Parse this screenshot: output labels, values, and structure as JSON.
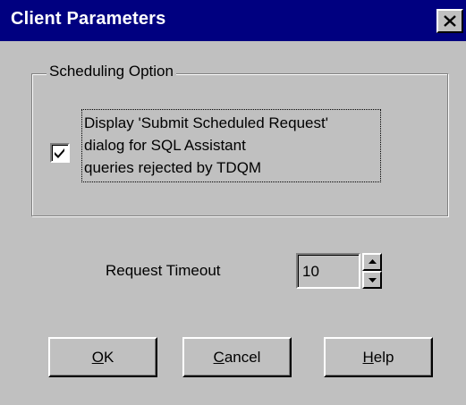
{
  "window": {
    "title": "Client Parameters",
    "close_icon": "close-icon"
  },
  "scheduling": {
    "group_label": "Scheduling Option",
    "checkbox_checked": true,
    "checkbox_label": "Display 'Submit Scheduled Request'\ndialog for SQL Assistant\nqueries rejected by TDQM"
  },
  "timeout": {
    "label": "Request Timeout",
    "value": "10",
    "spin_up_icon": "spin-up-icon",
    "spin_down_icon": "spin-down-icon"
  },
  "buttons": {
    "ok": {
      "mnemonic": "O",
      "rest": "K"
    },
    "cancel": {
      "mnemonic": "C",
      "rest": "ancel"
    },
    "help": {
      "mnemonic": "H",
      "rest": "elp"
    }
  }
}
